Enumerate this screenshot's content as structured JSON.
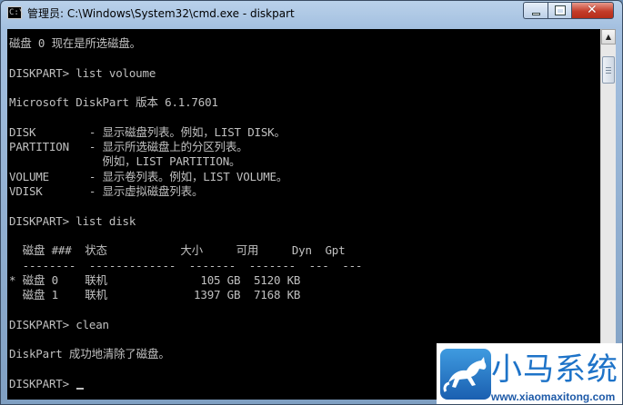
{
  "window": {
    "icon_text": "C:\\",
    "title": "管理员: C:\\Windows\\System32\\cmd.exe - diskpart"
  },
  "console": {
    "lines": [
      "磁盘 0 现在是所选磁盘。",
      "",
      "DISKPART> list voloume",
      "",
      "Microsoft DiskPart 版本 6.1.7601",
      "",
      "DISK        - 显示磁盘列表。例如，LIST DISK。",
      "PARTITION   - 显示所选磁盘上的分区列表。",
      "              例如，LIST PARTITION。",
      "VOLUME      - 显示卷列表。例如，LIST VOLUME。",
      "VDISK       - 显示虚拟磁盘列表。",
      "",
      "DISKPART> list disk",
      "",
      "  磁盘 ###  状态           大小     可用     Dyn  Gpt",
      "  --------  -------------  -------  -------  ---  ---",
      "* 磁盘 0    联机              105 GB  5120 KB",
      "  磁盘 1    联机             1397 GB  7168 KB",
      "",
      "DISKPART> clean",
      "",
      "DiskPart 成功地清除了磁盘。",
      "",
      "DISKPART> "
    ]
  },
  "scrollbar": {
    "up": "▲",
    "down": "▼"
  },
  "watermark": {
    "title": "小马系统",
    "url": "www.xiaomaxitong.com"
  },
  "colors": {
    "console_bg": "#000000",
    "console_fg": "#c0c0c0",
    "close_button": "#c43d2a",
    "watermark_blue": "#1e73c8"
  }
}
